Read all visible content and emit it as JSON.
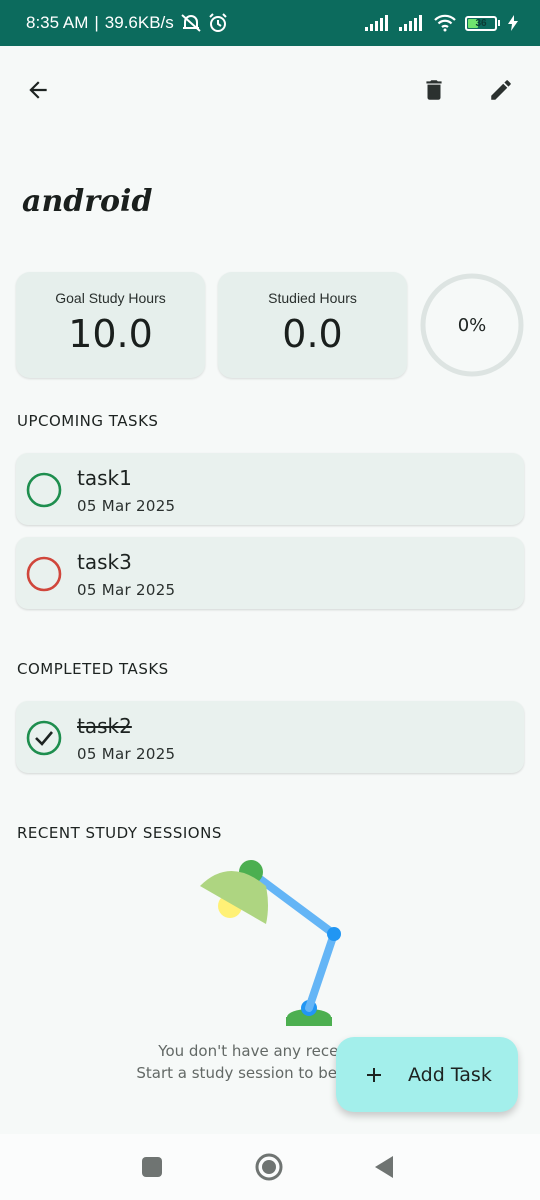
{
  "status_bar": {
    "time": "8:35 AM",
    "separator": "|",
    "network_speed": "39.6KB/s",
    "battery_level": "36"
  },
  "subject": {
    "title": "android"
  },
  "stats": {
    "goal_label": "Goal Study Hours",
    "goal_value": "10.0",
    "studied_label": "Studied Hours",
    "studied_value": "0.0",
    "progress_text": "0%"
  },
  "upcoming": {
    "heading": "UPCOMING TASKS",
    "tasks": [
      {
        "title": "task1",
        "date": "05 Mar 2025",
        "priority_color": "#1e8e4e"
      },
      {
        "title": "task3",
        "date": "05 Mar 2025",
        "priority_color": "#d0463b"
      }
    ]
  },
  "completed": {
    "heading": "COMPLETED TASKS",
    "tasks": [
      {
        "title": "task2",
        "date": "05 Mar 2025",
        "priority_color": "#1e8e4e"
      }
    ]
  },
  "sessions": {
    "heading": "RECENT STUDY SESSIONS",
    "empty_line1": "You don't have any recent stu",
    "empty_line2": "Start a study session to begin recor"
  },
  "fab": {
    "label": "Add Task",
    "icon": "plus-icon"
  },
  "colors": {
    "status_bar": "#0c6b5d",
    "card": "#e6efec",
    "fab": "#a3efeb"
  }
}
